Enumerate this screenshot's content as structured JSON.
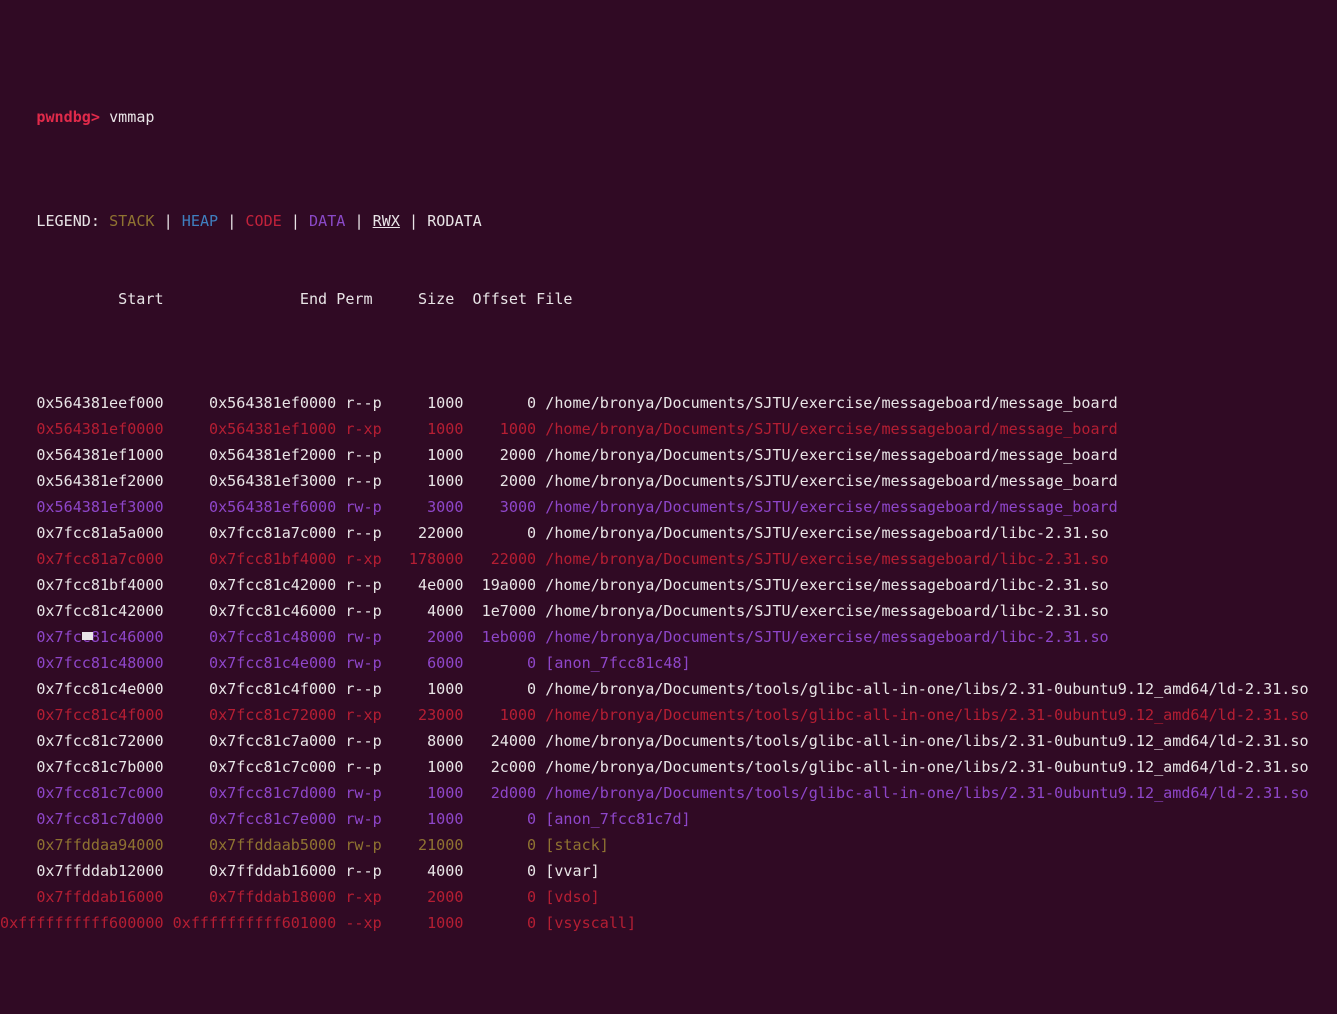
{
  "terminal": {
    "background": "#300a24",
    "foreground": "#e8e4e6",
    "cursor_color": "#e8e4e6"
  },
  "prompt": {
    "label": "pwndbg>",
    "command": "vmmap",
    "color": "#e02a4a"
  },
  "legend": {
    "label": "LEGEND:",
    "separator": "|",
    "items": [
      {
        "name": "STACK",
        "color": "#8f7331",
        "underline": false
      },
      {
        "name": "HEAP",
        "color": "#3f7fbf",
        "underline": false
      },
      {
        "name": "CODE",
        "color": "#c3223b",
        "underline": false
      },
      {
        "name": "DATA",
        "color": "#8a49c7",
        "underline": false
      },
      {
        "name": "RWX",
        "color": "#e8e4e6",
        "underline": true
      },
      {
        "name": "RODATA",
        "color": "#e8e4e6",
        "underline": false
      }
    ]
  },
  "table": {
    "headers": {
      "start": "Start",
      "end": "End",
      "perm": "Perm",
      "size": "Size",
      "offset": "Offset",
      "file": "File"
    },
    "header_line": "             Start               End Perm     Size  Offset File",
    "rows": [
      {
        "start": "0x564381eef000",
        "end": "0x564381ef0000",
        "perm": "r--p",
        "size": "1000",
        "offset": "0",
        "file": "/home/bronya/Documents/SJTU/exercise/messageboard/message_board",
        "color": "white"
      },
      {
        "start": "0x564381ef0000",
        "end": "0x564381ef1000",
        "perm": "r-xp",
        "size": "1000",
        "offset": "1000",
        "file": "/home/bronya/Documents/SJTU/exercise/messageboard/message_board",
        "color": "red"
      },
      {
        "start": "0x564381ef1000",
        "end": "0x564381ef2000",
        "perm": "r--p",
        "size": "1000",
        "offset": "2000",
        "file": "/home/bronya/Documents/SJTU/exercise/messageboard/message_board",
        "color": "white"
      },
      {
        "start": "0x564381ef2000",
        "end": "0x564381ef3000",
        "perm": "r--p",
        "size": "1000",
        "offset": "2000",
        "file": "/home/bronya/Documents/SJTU/exercise/messageboard/message_board",
        "color": "white"
      },
      {
        "start": "0x564381ef3000",
        "end": "0x564381ef6000",
        "perm": "rw-p",
        "size": "3000",
        "offset": "3000",
        "file": "/home/bronya/Documents/SJTU/exercise/messageboard/message_board",
        "color": "purple"
      },
      {
        "start": "0x7fcc81a5a000",
        "end": "0x7fcc81a7c000",
        "perm": "r--p",
        "size": "22000",
        "offset": "0",
        "file": "/home/bronya/Documents/SJTU/exercise/messageboard/libc-2.31.so",
        "color": "white"
      },
      {
        "start": "0x7fcc81a7c000",
        "end": "0x7fcc81bf4000",
        "perm": "r-xp",
        "size": "178000",
        "offset": "22000",
        "file": "/home/bronya/Documents/SJTU/exercise/messageboard/libc-2.31.so",
        "color": "red"
      },
      {
        "start": "0x7fcc81bf4000",
        "end": "0x7fcc81c42000",
        "perm": "r--p",
        "size": "4e000",
        "offset": "19a000",
        "file": "/home/bronya/Documents/SJTU/exercise/messageboard/libc-2.31.so",
        "color": "white"
      },
      {
        "start": "0x7fcc81c42000",
        "end": "0x7fcc81c46000",
        "perm": "r--p",
        "size": "4000",
        "offset": "1e7000",
        "file": "/home/bronya/Documents/SJTU/exercise/messageboard/libc-2.31.so",
        "color": "white"
      },
      {
        "start": "0x7fcc81c46000",
        "end": "0x7fcc81c48000",
        "perm": "rw-p",
        "size": "2000",
        "offset": "1eb000",
        "file": "/home/bronya/Documents/SJTU/exercise/messageboard/libc-2.31.so",
        "color": "purple"
      },
      {
        "start": "0x7fcc81c48000",
        "end": "0x7fcc81c4e000",
        "perm": "rw-p",
        "size": "6000",
        "offset": "0",
        "file": "[anon_7fcc81c48]",
        "color": "purple"
      },
      {
        "start": "0x7fcc81c4e000",
        "end": "0x7fcc81c4f000",
        "perm": "r--p",
        "size": "1000",
        "offset": "0",
        "file": "/home/bronya/Documents/tools/glibc-all-in-one/libs/2.31-0ubuntu9.12_amd64/ld-2.31.so",
        "color": "white"
      },
      {
        "start": "0x7fcc81c4f000",
        "end": "0x7fcc81c72000",
        "perm": "r-xp",
        "size": "23000",
        "offset": "1000",
        "file": "/home/bronya/Documents/tools/glibc-all-in-one/libs/2.31-0ubuntu9.12_amd64/ld-2.31.so",
        "color": "red"
      },
      {
        "start": "0x7fcc81c72000",
        "end": "0x7fcc81c7a000",
        "perm": "r--p",
        "size": "8000",
        "offset": "24000",
        "file": "/home/bronya/Documents/tools/glibc-all-in-one/libs/2.31-0ubuntu9.12_amd64/ld-2.31.so",
        "color": "white"
      },
      {
        "start": "0x7fcc81c7b000",
        "end": "0x7fcc81c7c000",
        "perm": "r--p",
        "size": "1000",
        "offset": "2c000",
        "file": "/home/bronya/Documents/tools/glibc-all-in-one/libs/2.31-0ubuntu9.12_amd64/ld-2.31.so",
        "color": "white"
      },
      {
        "start": "0x7fcc81c7c000",
        "end": "0x7fcc81c7d000",
        "perm": "rw-p",
        "size": "1000",
        "offset": "2d000",
        "file": "/home/bronya/Documents/tools/glibc-all-in-one/libs/2.31-0ubuntu9.12_amd64/ld-2.31.so",
        "color": "purple"
      },
      {
        "start": "0x7fcc81c7d000",
        "end": "0x7fcc81c7e000",
        "perm": "rw-p",
        "size": "1000",
        "offset": "0",
        "file": "[anon_7fcc81c7d]",
        "color": "purple"
      },
      {
        "start": "0x7ffddaa94000",
        "end": "0x7ffddaab5000",
        "perm": "rw-p",
        "size": "21000",
        "offset": "0",
        "file": "[stack]",
        "color": "olive"
      },
      {
        "start": "0x7ffddab12000",
        "end": "0x7ffddab16000",
        "perm": "r--p",
        "size": "4000",
        "offset": "0",
        "file": "[vvar]",
        "color": "white"
      },
      {
        "start": "0x7ffddab16000",
        "end": "0x7ffddab18000",
        "perm": "r-xp",
        "size": "2000",
        "offset": "0",
        "file": "[vdso]",
        "color": "red"
      },
      {
        "start": "0xffffffffff600000",
        "end": "0xffffffffff601000",
        "perm": "--xp",
        "size": "1000",
        "offset": "0",
        "file": "[vsyscall]",
        "color": "red"
      }
    ]
  }
}
